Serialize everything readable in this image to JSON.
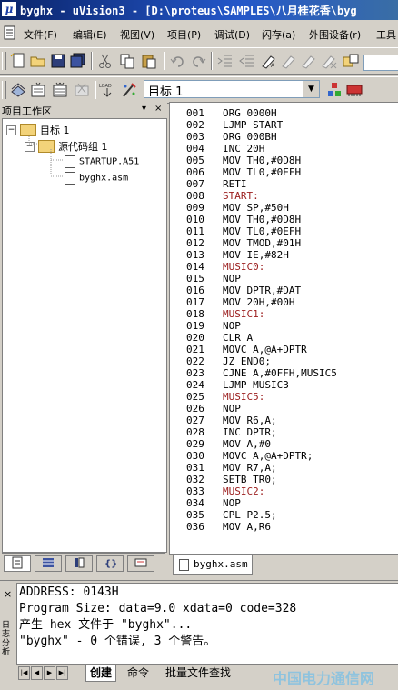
{
  "window": {
    "title": "byghx  - uVision3 - [D:\\proteus\\SAMPLES\\八月桂花香\\byg"
  },
  "menu": [
    "文件(F)",
    "编辑(E)",
    "视图(V)",
    "项目(P)",
    "调试(D)",
    "闪存(a)",
    "外围设备(r)",
    "工具"
  ],
  "build_toolbar": {
    "target": "目标 1"
  },
  "project_pane": {
    "title": "项目工作区",
    "controls": [
      "▾",
      "×"
    ],
    "tree": {
      "target": "目标 1",
      "group": "源代码组 1",
      "files": [
        "STARTUP.A51",
        "byghx.asm"
      ]
    },
    "tabs": [
      "files-icon",
      "regs-icon",
      "books-icon",
      "functions-icon",
      "templates-icon"
    ]
  },
  "editor": {
    "lines": [
      {
        "n": "001",
        "code": "ORG 0000H",
        "label": false
      },
      {
        "n": "002",
        "code": "LJMP START",
        "label": false
      },
      {
        "n": "003",
        "code": "ORG 000BH",
        "label": false
      },
      {
        "n": "004",
        "code": "INC 20H",
        "label": false
      },
      {
        "n": "005",
        "code": "MOV TH0,#0D8H",
        "label": false
      },
      {
        "n": "006",
        "code": "MOV TL0,#0EFH",
        "label": false
      },
      {
        "n": "007",
        "code": "RETI",
        "label": false
      },
      {
        "n": "008",
        "code": "START:",
        "label": true
      },
      {
        "n": "009",
        "code": "MOV SP,#50H",
        "label": false
      },
      {
        "n": "010",
        "code": "MOV TH0,#0D8H",
        "label": false
      },
      {
        "n": "011",
        "code": "MOV TL0,#0EFH",
        "label": false
      },
      {
        "n": "012",
        "code": "MOV TMOD,#01H",
        "label": false
      },
      {
        "n": "013",
        "code": "MOV IE,#82H",
        "label": false
      },
      {
        "n": "014",
        "code": "MUSIC0:",
        "label": true
      },
      {
        "n": "015",
        "code": "NOP",
        "label": false
      },
      {
        "n": "016",
        "code": "MOV DPTR,#DAT",
        "label": false
      },
      {
        "n": "017",
        "code": "MOV 20H,#00H",
        "label": false
      },
      {
        "n": "018",
        "code": "MUSIC1:",
        "label": true
      },
      {
        "n": "019",
        "code": "NOP",
        "label": false
      },
      {
        "n": "020",
        "code": "CLR A",
        "label": false
      },
      {
        "n": "021",
        "code": "MOVC A,@A+DPTR",
        "label": false
      },
      {
        "n": "022",
        "code": "JZ END0;",
        "label": false
      },
      {
        "n": "023",
        "code": "CJNE A,#0FFH,MUSIC5",
        "label": false
      },
      {
        "n": "024",
        "code": "LJMP MUSIC3",
        "label": false
      },
      {
        "n": "025",
        "code": "MUSIC5:",
        "label": true
      },
      {
        "n": "026",
        "code": "NOP",
        "label": false
      },
      {
        "n": "027",
        "code": "MOV R6,A;",
        "label": false
      },
      {
        "n": "028",
        "code": "INC DPTR;",
        "label": false
      },
      {
        "n": "029",
        "code": "MOV A,#0",
        "label": false
      },
      {
        "n": "030",
        "code": "MOVC A,@A+DPTR;",
        "label": false
      },
      {
        "n": "031",
        "code": "MOV R7,A;",
        "label": false
      },
      {
        "n": "032",
        "code": "SETB TR0;",
        "label": false
      },
      {
        "n": "033",
        "code": "MUSIC2:",
        "label": true
      },
      {
        "n": "034",
        "code": "NOP",
        "label": false
      },
      {
        "n": "035",
        "code": "CPL P2.5;",
        "label": false
      },
      {
        "n": "036",
        "code": "MOV A,R6",
        "label": false
      }
    ],
    "tab": "byghx.asm"
  },
  "output": {
    "side_label": "日志分析",
    "lines": [
      "     ADDRESS:  0143H",
      "Program Size: data=9.0 xdata=0 code=328",
      "产生 hex 文件于 \"byghx\"...",
      "\"byghx\" - 0 个错误, 3 个警告。"
    ],
    "tabs": [
      "创建",
      "命令",
      "批量文件查找"
    ]
  },
  "watermark": "中国电力通信网"
}
